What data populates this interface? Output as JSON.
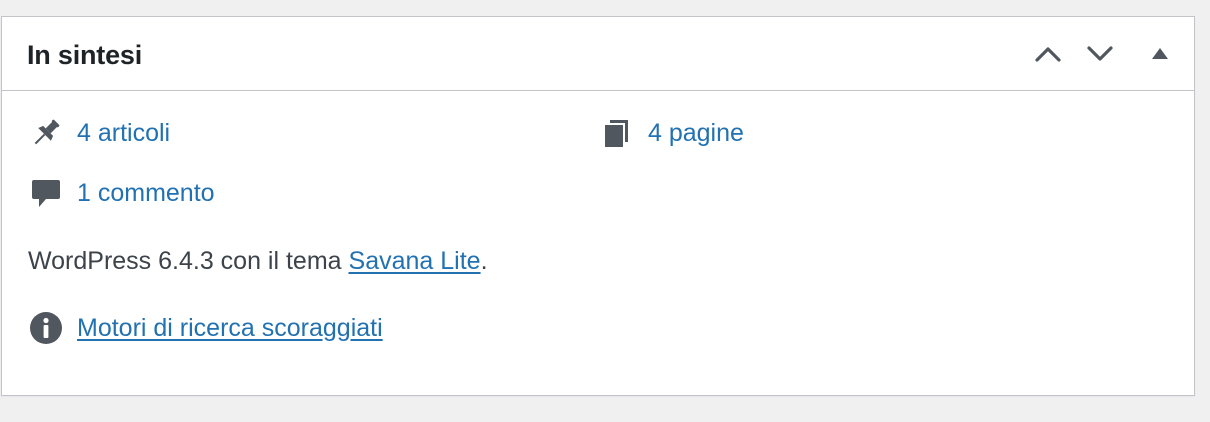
{
  "widget": {
    "title": "In sintesi",
    "actions": {
      "move_up_icon": "chevron-up-icon",
      "move_down_icon": "chevron-down-icon",
      "toggle_icon": "triangle-up-icon"
    }
  },
  "stats": {
    "posts": {
      "label": "4 articoli",
      "icon": "pin-icon"
    },
    "pages": {
      "label": "4 pagine",
      "icon": "pages-icon"
    },
    "comments": {
      "label": "1 commento",
      "icon": "comment-icon"
    }
  },
  "wordpress": {
    "text_before": "WordPress 6.4.3 con il tema ",
    "theme_link": "Savana Lite",
    "text_after": "."
  },
  "search_engines": {
    "label": "Motori di ricerca scoraggiati",
    "icon": "info-icon"
  },
  "colors": {
    "link": "#2271b1",
    "text": "#3c434a",
    "icon": "#50575e",
    "border": "#c3c4c7",
    "background": "#f0f0f1"
  }
}
